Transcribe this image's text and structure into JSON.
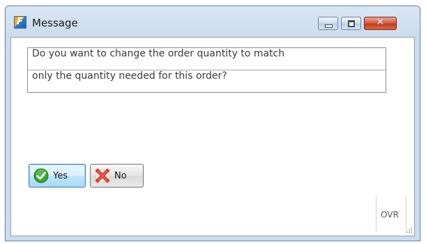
{
  "window": {
    "title": "Message",
    "app_icon": "F-logo-icon",
    "controls": {
      "minimize": "minimize-icon",
      "maximize": "maximize-icon",
      "close": "close-icon"
    }
  },
  "message": {
    "lines": [
      "Do you want to change the order quantity to match",
      "only the quantity needed for this order?"
    ]
  },
  "buttons": {
    "yes_label": "Yes",
    "yes_icon": "green-check-icon",
    "no_label": "No",
    "no_icon": "red-x-icon"
  },
  "statusbar": {
    "mode": "OVR"
  },
  "colors": {
    "titlebar": "#cbdcee",
    "close_button": "#c2391c",
    "yes_accent": "#bee6fd",
    "check_green": "#3aa52e",
    "no_red": "#d8372a"
  }
}
